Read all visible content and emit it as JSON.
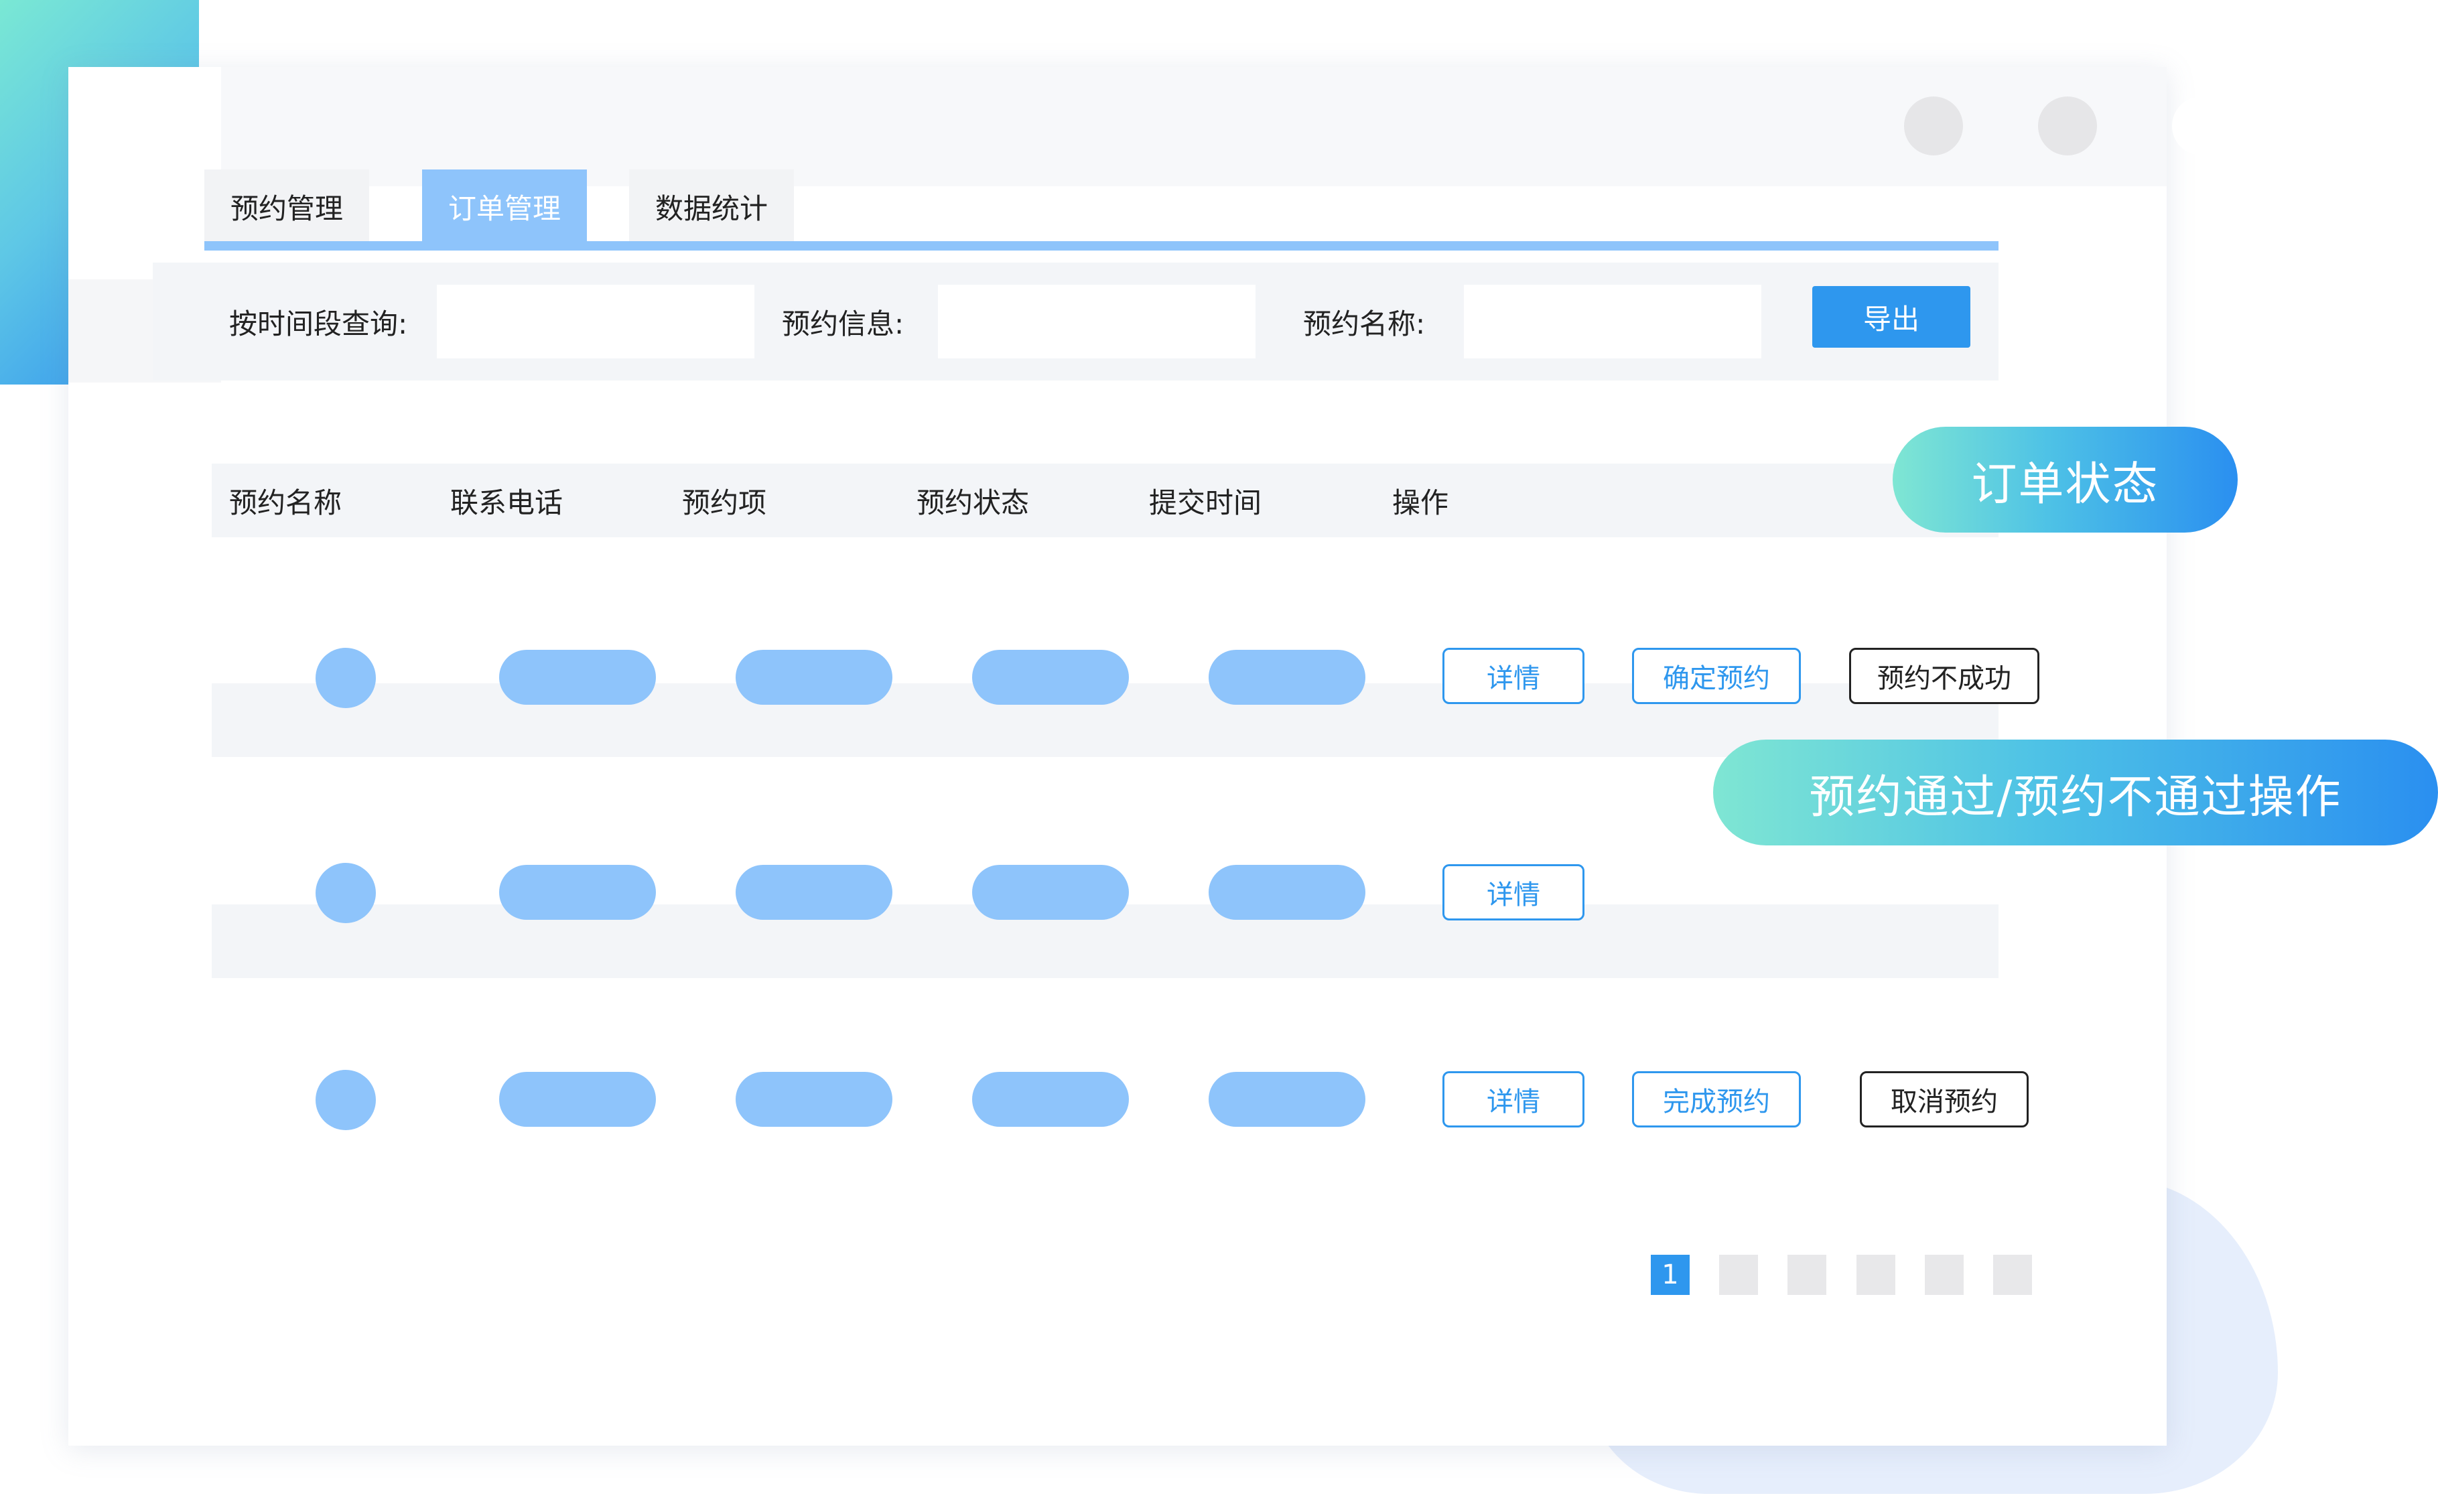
{
  "tabs": [
    {
      "label": "预约管理",
      "active": false
    },
    {
      "label": "订单管理",
      "active": true
    },
    {
      "label": "数据统计",
      "active": false
    }
  ],
  "filters": {
    "time_label": "按时间段查询:",
    "info_label": "预约信息:",
    "name_label": "预约名称:",
    "time_value": "",
    "info_value": "",
    "name_value": "",
    "export_label": "导出"
  },
  "table": {
    "columns": [
      "预约名称",
      "联系电话",
      "预约项",
      "预约状态",
      "提交时间",
      "操作"
    ],
    "rows": [
      {
        "actions": [
          "详情",
          "确定预约",
          "预约不成功"
        ]
      },
      {
        "actions": [
          "详情"
        ]
      },
      {
        "actions": [
          "详情",
          "完成预约",
          "取消预约"
        ]
      }
    ]
  },
  "callouts": {
    "status": "订单状态",
    "operation": "预约通过/预约不通过操作"
  },
  "pagination": {
    "current": "1",
    "total_pages": 6
  },
  "colors": {
    "accent": "#2e97ee",
    "placeholder_fill": "#8ec4fb",
    "tab_active": "#8ec4fb"
  }
}
